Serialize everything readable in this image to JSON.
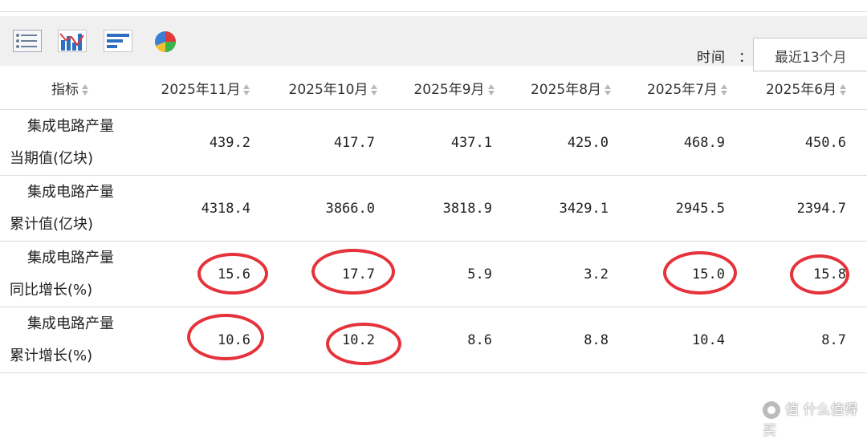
{
  "toolbar": {
    "icons": [
      "list-view-icon",
      "chart-view-icon",
      "bar-view-icon",
      "pie-view-icon"
    ],
    "time_label": "时间",
    "time_colon": "：",
    "time_value": "最近13个月"
  },
  "table": {
    "headers": [
      "指标",
      "2025年11月",
      "2025年10月",
      "2025年9月",
      "2025年8月",
      "2025年7月",
      "2025年6月"
    ],
    "rows": [
      {
        "line1": "集成电路产量",
        "line2": "当期值(亿块)",
        "values": [
          "439.2",
          "417.7",
          "437.1",
          "425.0",
          "468.9",
          "450.6"
        ]
      },
      {
        "line1": "集成电路产量",
        "line2": "累计值(亿块)",
        "values": [
          "4318.4",
          "3866.0",
          "3818.9",
          "3429.1",
          "2945.5",
          "2394.7"
        ]
      },
      {
        "line1": "集成电路产量",
        "line2": "同比增长(%)",
        "values": [
          "15.6",
          "17.7",
          "5.9",
          "3.2",
          "15.0",
          "15.8"
        ]
      },
      {
        "line1": "集成电路产量",
        "line2": "累计增长(%)",
        "values": [
          "10.6",
          "10.2",
          "8.6",
          "8.8",
          "10.4",
          "8.7"
        ]
      }
    ]
  },
  "highlight_color": "#e5323b",
  "watermark": "值 什么值得买"
}
